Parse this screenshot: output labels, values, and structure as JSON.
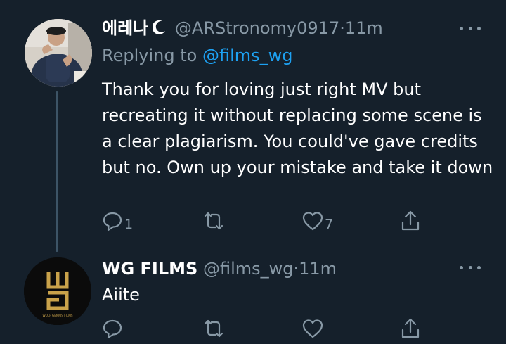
{
  "colors": {
    "background": "#15202b",
    "primary_text": "#ffffff",
    "secondary_text": "#8899a6",
    "link": "#1da1f2",
    "thread_line": "#3d5466",
    "brand_gold": "#c9a24a"
  },
  "tweets": [
    {
      "display_name": "에레나",
      "name_icon": "crescent-moon-icon",
      "handle": "@ARStronomy0917",
      "separator": "·",
      "time": "11m",
      "replying_prefix": "Replying to",
      "replying_handle": "@films_wg",
      "body": "Thank you for loving just right MV but recreating it without replacing some scene is a  clear plagiarism. You could've gave credits but no. Own up your mistake and take it down",
      "reply_count": "1",
      "retweet_count": "",
      "like_count": "7"
    },
    {
      "display_name": "WG FILMS",
      "handle": "@films_wg",
      "separator": "·",
      "time": "11m",
      "body": "Aiite",
      "avatar_logo_text": "WOLF GENIUS FILMS",
      "reply_count": "",
      "retweet_count": "",
      "like_count": ""
    }
  ]
}
